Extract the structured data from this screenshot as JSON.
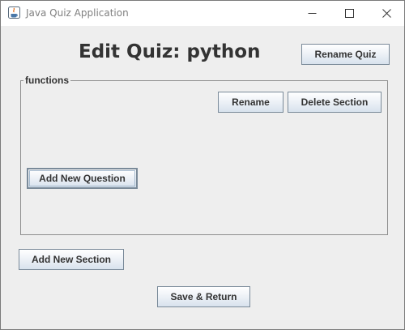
{
  "window": {
    "title": "Java Quiz Application",
    "icons": {
      "app": "java-app-icon",
      "minimize": "minimize-icon",
      "maximize": "maximize-icon",
      "close": "close-icon"
    }
  },
  "header": {
    "title": "Edit Quiz: python",
    "rename_quiz_label": "Rename Quiz"
  },
  "section": {
    "name": "functions",
    "rename_label": "Rename",
    "delete_label": "Delete Section",
    "add_question_label": "Add New Question"
  },
  "footer": {
    "add_section_label": "Add New Section",
    "save_return_label": "Save & Return"
  },
  "colors": {
    "window_background": "#eeeeee",
    "titlebar_background": "#ffffff",
    "heading_text": "#333333",
    "button_border": "#7a8a99"
  }
}
